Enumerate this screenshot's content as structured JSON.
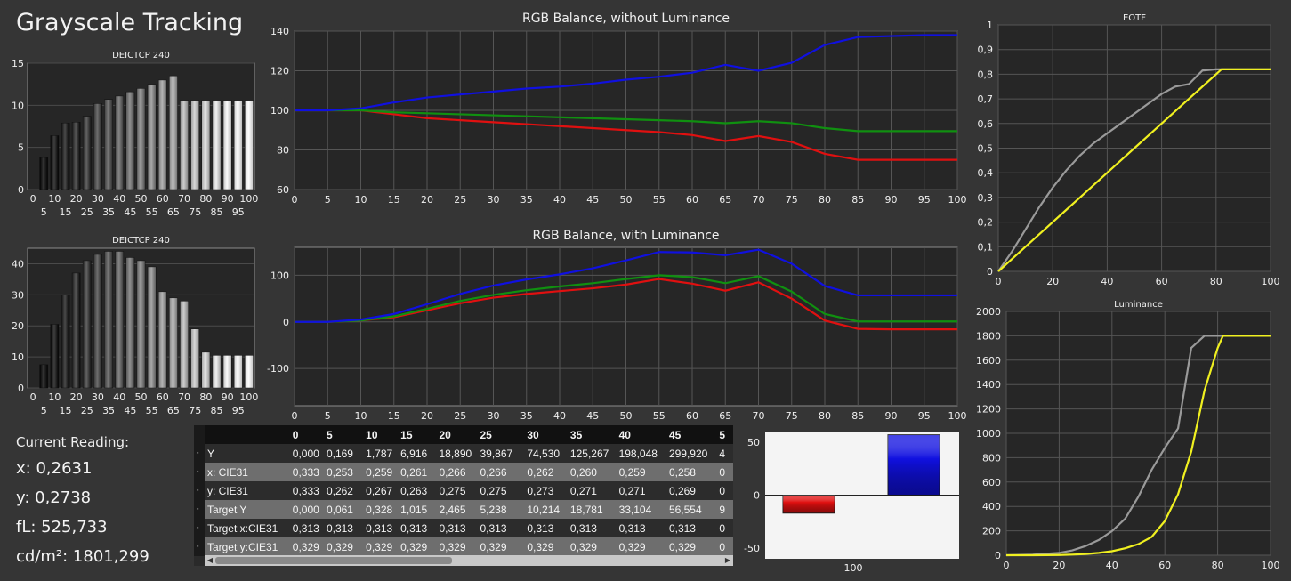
{
  "title": "Grayscale Tracking",
  "current_reading": {
    "label": "Current Reading:",
    "x": "x: 0,2631",
    "y": "y: 0,2738",
    "fl": "fL: 525,733",
    "cdm2": "cd/m²: 1801,299"
  },
  "colors": {
    "red": "#e01010",
    "green": "#109010",
    "blue": "#1010e0",
    "yellow": "#f0f020",
    "gray": "#9a9a9a",
    "plot_bg": "#262626",
    "panel_bg": "#353535"
  },
  "chart_data": [
    {
      "id": "deltae-top",
      "type": "bar",
      "title": "DEICTCP 240",
      "categories": [
        0,
        5,
        10,
        15,
        20,
        25,
        30,
        35,
        40,
        45,
        50,
        55,
        60,
        65,
        70,
        75,
        80,
        85,
        90,
        95,
        100
      ],
      "values": [
        0,
        3.8,
        6.4,
        7.9,
        8.0,
        8.7,
        10.2,
        10.7,
        11.1,
        11.6,
        12.0,
        12.5,
        13.0,
        13.5,
        10.6,
        10.6,
        10.6,
        10.6,
        10.6,
        10.6,
        10.6
      ],
      "ylim": [
        0,
        15
      ],
      "yticks": [
        0,
        5,
        10,
        15
      ],
      "xticks_top": [
        0,
        10,
        20,
        30,
        40,
        50,
        60,
        70,
        80,
        90,
        100
      ],
      "xticks_bottom": [
        5,
        15,
        25,
        35,
        45,
        55,
        65,
        75,
        85,
        95
      ]
    },
    {
      "id": "deltae-bottom",
      "type": "bar",
      "title": "DEICTCP 240",
      "categories": [
        0,
        5,
        10,
        15,
        20,
        25,
        30,
        35,
        40,
        45,
        50,
        55,
        60,
        65,
        70,
        75,
        80,
        85,
        90,
        95,
        100
      ],
      "values": [
        0,
        7.5,
        20.5,
        30,
        37,
        41,
        43,
        44,
        44,
        42,
        41,
        39,
        31,
        29,
        28,
        19,
        11.5,
        10.5,
        10.5,
        10.5,
        10.5
      ],
      "ylim": [
        0,
        45
      ],
      "yticks": [
        0,
        10,
        20,
        30,
        40
      ],
      "xticks_top": [
        0,
        10,
        20,
        30,
        40,
        50,
        60,
        70,
        80,
        90,
        100
      ],
      "xticks_bottom": [
        5,
        15,
        25,
        35,
        45,
        55,
        65,
        75,
        85,
        95
      ]
    },
    {
      "id": "rgb-no-lum",
      "type": "line",
      "title": "RGB Balance, without Luminance",
      "x": [
        0,
        5,
        10,
        15,
        20,
        25,
        30,
        35,
        40,
        45,
        50,
        55,
        60,
        65,
        70,
        75,
        80,
        85,
        90,
        95,
        100
      ],
      "series": [
        {
          "color": "red",
          "values": [
            100,
            100,
            100,
            98,
            96,
            95,
            94,
            93,
            92,
            91,
            90,
            89,
            87.5,
            84.5,
            87,
            84,
            78,
            75,
            75,
            75,
            75
          ]
        },
        {
          "color": "green",
          "values": [
            100,
            100,
            100,
            99,
            98.5,
            98,
            97.5,
            97,
            96.5,
            96,
            95.5,
            95,
            94.5,
            93.5,
            94.5,
            93.5,
            91,
            89.5,
            89.5,
            89.5,
            89.5
          ]
        },
        {
          "color": "blue",
          "values": [
            100,
            100,
            101,
            104,
            106.5,
            108,
            109.5,
            111,
            112,
            113.5,
            115.5,
            117,
            119,
            123,
            120,
            124,
            133,
            137,
            137.5,
            138,
            138
          ]
        }
      ],
      "ylim": [
        60,
        140
      ],
      "yticks": [
        60,
        80,
        100,
        120,
        140
      ],
      "xticks": [
        0,
        5,
        10,
        15,
        20,
        25,
        30,
        35,
        40,
        45,
        50,
        55,
        60,
        65,
        70,
        75,
        80,
        85,
        90,
        95,
        100
      ]
    },
    {
      "id": "rgb-lum",
      "type": "line",
      "title": "RGB Balance, with Luminance",
      "x": [
        0,
        5,
        10,
        15,
        20,
        25,
        30,
        35,
        40,
        45,
        50,
        55,
        60,
        65,
        70,
        75,
        80,
        85,
        90,
        95,
        100
      ],
      "series": [
        {
          "color": "red",
          "values": [
            0,
            0,
            3,
            10,
            25,
            40,
            52,
            60,
            66,
            72,
            80,
            92,
            82,
            67,
            85,
            50,
            3,
            -15,
            -16,
            -16,
            -16
          ]
        },
        {
          "color": "green",
          "values": [
            0,
            0,
            3,
            12,
            28,
            45,
            58,
            68,
            76,
            83,
            92,
            100,
            96,
            83,
            98,
            65,
            17,
            1,
            1,
            1,
            1
          ]
        },
        {
          "color": "blue",
          "values": [
            0,
            0,
            5,
            17,
            38,
            60,
            78,
            91,
            102,
            115,
            132,
            150,
            149,
            143,
            155,
            125,
            77,
            57,
            57,
            57,
            57
          ]
        }
      ],
      "ylim": [
        -180,
        160
      ],
      "yticks": [
        -100,
        0,
        100
      ],
      "xticks": [
        0,
        5,
        10,
        15,
        20,
        25,
        30,
        35,
        40,
        45,
        50,
        55,
        60,
        65,
        70,
        75,
        80,
        85,
        90,
        95,
        100
      ]
    },
    {
      "id": "rgb-bars",
      "type": "bar",
      "categories": [
        "100"
      ],
      "series": [
        {
          "color": "red",
          "values": [
            -17
          ]
        },
        {
          "color": "green",
          "values": [
            0
          ]
        },
        {
          "color": "blue",
          "values": [
            57
          ]
        }
      ],
      "ylim": [
        -60,
        60
      ],
      "yticks": [
        -50,
        0,
        50
      ],
      "xlabel": "100"
    },
    {
      "id": "eotf",
      "type": "line",
      "title": "EOTF",
      "x": [
        0,
        5,
        10,
        15,
        20,
        25,
        30,
        35,
        40,
        45,
        50,
        55,
        60,
        65,
        70,
        75,
        80,
        82,
        90,
        95,
        100
      ],
      "series": [
        {
          "color": "gray",
          "values": [
            0,
            0.08,
            0.17,
            0.26,
            0.34,
            0.41,
            0.47,
            0.52,
            0.56,
            0.6,
            0.64,
            0.68,
            0.72,
            0.75,
            0.76,
            0.815,
            0.82,
            0.82,
            0.82,
            0.82,
            0.82
          ]
        },
        {
          "color": "yellow",
          "values": [
            0,
            0.05,
            0.1,
            0.15,
            0.2,
            0.25,
            0.3,
            0.35,
            0.4,
            0.45,
            0.5,
            0.55,
            0.6,
            0.65,
            0.7,
            0.75,
            0.8,
            0.82,
            0.82,
            0.82,
            0.82
          ]
        }
      ],
      "ylim": [
        0,
        1
      ],
      "yticks": [
        0,
        0.1,
        0.2,
        0.3,
        0.4,
        0.5,
        0.6,
        0.7,
        0.8,
        0.9,
        1
      ],
      "xticks": [
        0,
        20,
        40,
        60,
        80,
        100
      ]
    },
    {
      "id": "luminance",
      "type": "line",
      "title": "Luminance",
      "x": [
        0,
        10,
        20,
        25,
        30,
        35,
        40,
        45,
        50,
        55,
        60,
        65,
        70,
        75,
        80,
        82,
        85,
        90,
        95,
        100
      ],
      "series": [
        {
          "color": "gray",
          "values": [
            0,
            5,
            19,
            40,
            75,
            125,
            198,
            300,
            480,
            700,
            880,
            1040,
            1700,
            1800,
            1800,
            1800,
            1800,
            1800,
            1800,
            1800
          ]
        },
        {
          "color": "yellow",
          "values": [
            0,
            0,
            2,
            5,
            10,
            19,
            33,
            57,
            91,
            150,
            280,
            500,
            850,
            1350,
            1700,
            1800,
            1800,
            1800,
            1800,
            1800
          ]
        }
      ],
      "ylim": [
        0,
        2000
      ],
      "yticks": [
        0,
        200,
        400,
        600,
        800,
        1000,
        1200,
        1400,
        1600,
        1800,
        2000
      ],
      "xticks": [
        0,
        20,
        40,
        60,
        80,
        100
      ]
    }
  ],
  "table": {
    "columns": [
      "",
      "0",
      "5",
      "10",
      "15",
      "20",
      "25",
      "30",
      "35",
      "40",
      "45",
      "5"
    ],
    "rows": [
      [
        "Y",
        "0,000",
        "0,169",
        "1,787",
        "6,916",
        "18,890",
        "39,867",
        "74,530",
        "125,267",
        "198,048",
        "299,920",
        "4"
      ],
      [
        "x: CIE31",
        "0,333",
        "0,253",
        "0,259",
        "0,261",
        "0,266",
        "0,266",
        "0,262",
        "0,260",
        "0,259",
        "0,258",
        "0"
      ],
      [
        "y: CIE31",
        "0,333",
        "0,262",
        "0,267",
        "0,263",
        "0,275",
        "0,275",
        "0,273",
        "0,271",
        "0,271",
        "0,269",
        "0"
      ],
      [
        "Target Y",
        "0,000",
        "0,061",
        "0,328",
        "1,015",
        "2,465",
        "5,238",
        "10,214",
        "18,781",
        "33,104",
        "56,554",
        "9"
      ],
      [
        "Target x:CIE31",
        "0,313",
        "0,313",
        "0,313",
        "0,313",
        "0,313",
        "0,313",
        "0,313",
        "0,313",
        "0,313",
        "0,313",
        "0"
      ],
      [
        "Target y:CIE31",
        "0,329",
        "0,329",
        "0,329",
        "0,329",
        "0,329",
        "0,329",
        "0,329",
        "0,329",
        "0,329",
        "0,329",
        "0"
      ]
    ]
  }
}
